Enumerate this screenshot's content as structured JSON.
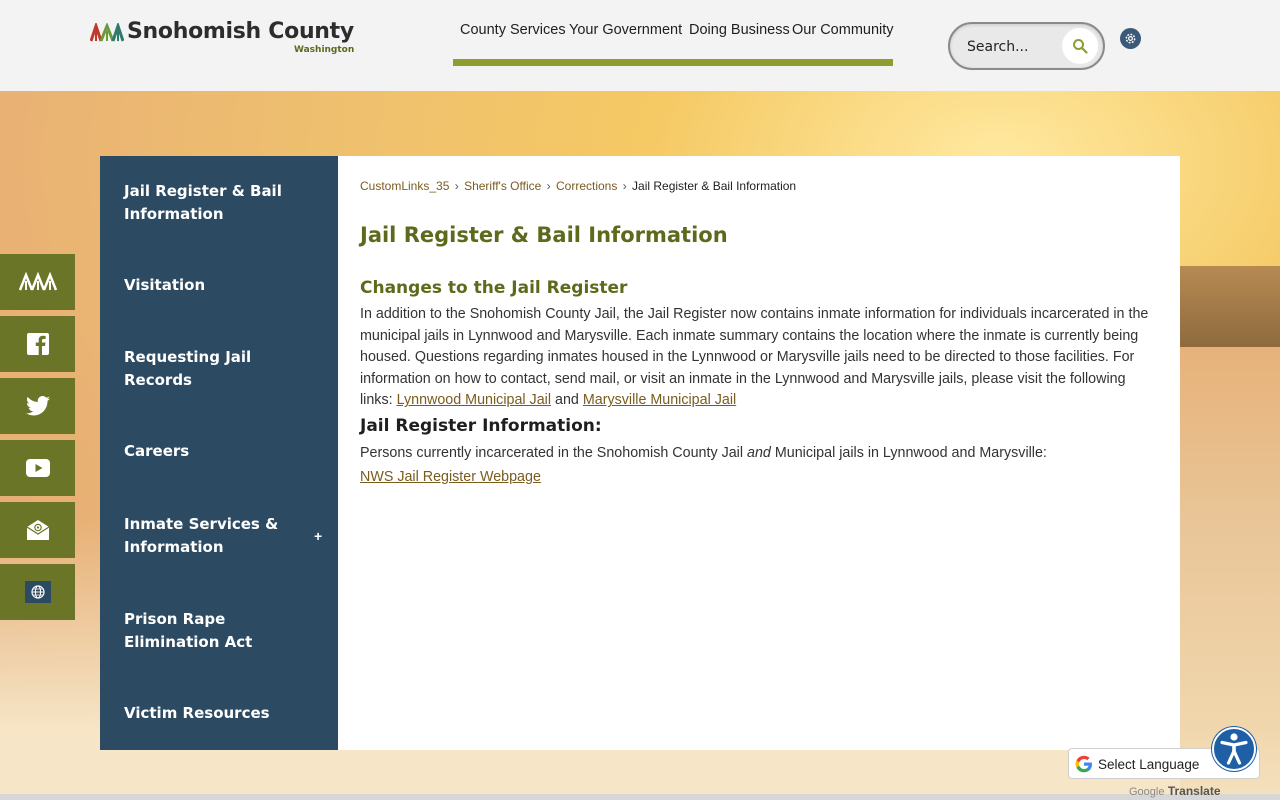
{
  "logo": {
    "name": "Snohomish County",
    "sub": "Washington"
  },
  "topnav": {
    "items": [
      "County Services",
      "Your Government",
      "Doing Business",
      "Our Community"
    ]
  },
  "search": {
    "placeholder": "Search..."
  },
  "social": {
    "icons": [
      "home-icon",
      "facebook-icon",
      "twitter-icon",
      "youtube-icon",
      "email-icon",
      "globe-icon"
    ]
  },
  "sidemenu": {
    "items": [
      "Jail Register & Bail Information",
      "Visitation",
      "Requesting Jail Records",
      "Careers",
      "Inmate Services & Information",
      "Prison Rape Elimination Act",
      "Victim Resources"
    ],
    "expand": "+"
  },
  "breadcrumb": {
    "items": [
      "CustomLinks_35",
      "Sheriff's Office",
      "Corrections"
    ],
    "current": "Jail Register & Bail Information",
    "sep": "›"
  },
  "content": {
    "title": "Jail Register & Bail Information",
    "section1_heading": "Changes to the Jail Register",
    "section1_text": "In addition to the Snohomish County Jail, the Jail Register now contains inmate information for individuals incarcerated in the municipal jails in Lynnwood and Marysville. Each inmate summary contains the location where the inmate is currently being housed. Questions regarding inmates housed in the Lynnwood or Marysville jails need to be directed to those facilities. For information on how to contact, send mail, or visit an inmate in the Lynnwood and Marysville jails, please visit the following links:",
    "link_lynnwood": "Lynnwood Municipal Jail",
    "and": "and",
    "link_marysville": "Marysville Municipal Jail",
    "section2_heading": "Jail Register Information:",
    "section2_text_a": "Persons currently incarcerated in the Snohomish County Jail",
    "section2_text_em": "and",
    "section2_text_b": "Municipal jails in Lynnwood and Marysville:",
    "link_nws": "NWS Jail Register Webpage"
  },
  "translate": {
    "label": "Select Language",
    "powered_brand": "Google",
    "powered_word": "Translate"
  },
  "colors": {
    "olive": "#5c6a1c",
    "navy": "#2c4a62",
    "social": "#6a7528",
    "link": "#7a5c1f"
  }
}
